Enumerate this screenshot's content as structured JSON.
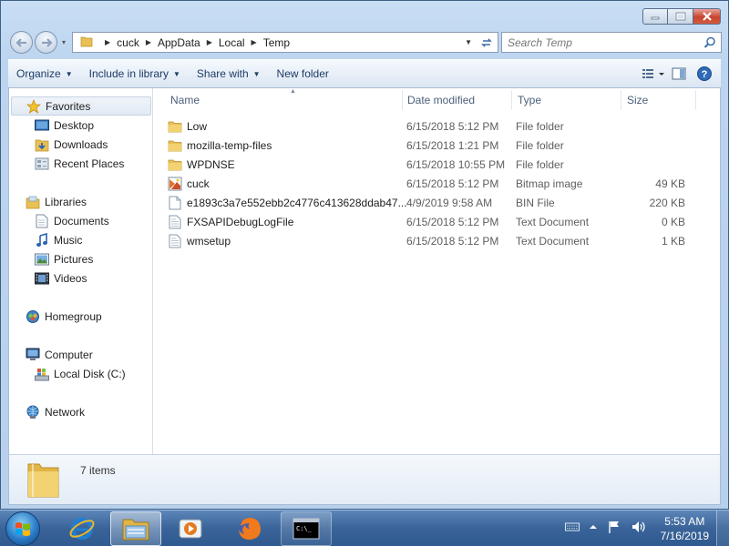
{
  "window": {
    "caption_buttons": {
      "minimize": "minimize-icon",
      "maximize": "maximize-icon",
      "close": "close-icon"
    }
  },
  "address": {
    "crumbs": [
      "cuck",
      "AppData",
      "Local",
      "Temp"
    ],
    "search_placeholder": "Search Temp"
  },
  "toolbar": {
    "organize": "Organize",
    "include_in_library": "Include in library",
    "share_with": "Share with",
    "new_folder": "New folder"
  },
  "nav": {
    "favorites": "Favorites",
    "desktop": "Desktop",
    "downloads": "Downloads",
    "recent_places": "Recent Places",
    "libraries": "Libraries",
    "documents": "Documents",
    "music": "Music",
    "pictures": "Pictures",
    "videos": "Videos",
    "homegroup": "Homegroup",
    "computer": "Computer",
    "local_disk": "Local Disk (C:)",
    "network": "Network"
  },
  "columns": {
    "name": "Name",
    "date": "Date modified",
    "type": "Type",
    "size": "Size"
  },
  "files": [
    {
      "name": "Low",
      "date": "6/15/2018 5:12 PM",
      "type": "File folder",
      "size": "",
      "icon": "folder-icon"
    },
    {
      "name": "mozilla-temp-files",
      "date": "6/15/2018 1:21 PM",
      "type": "File folder",
      "size": "",
      "icon": "folder-icon"
    },
    {
      "name": "WPDNSE",
      "date": "6/15/2018 10:55 PM",
      "type": "File folder",
      "size": "",
      "icon": "folder-icon"
    },
    {
      "name": "cuck",
      "date": "6/15/2018 5:12 PM",
      "type": "Bitmap image",
      "size": "49 KB",
      "icon": "bitmap-icon"
    },
    {
      "name": "e1893c3a7e552ebb2c4776c413628ddab47...",
      "date": "4/9/2019 9:58 AM",
      "type": "BIN File",
      "size": "220 KB",
      "icon": "file-icon"
    },
    {
      "name": "FXSAPIDebugLogFile",
      "date": "6/15/2018 5:12 PM",
      "type": "Text Document",
      "size": "0 KB",
      "icon": "text-file-icon"
    },
    {
      "name": "wmsetup",
      "date": "6/15/2018 5:12 PM",
      "type": "Text Document",
      "size": "1 KB",
      "icon": "text-file-icon"
    }
  ],
  "status": {
    "item_count": "7 items"
  },
  "taskbar": {
    "time": "5:53 AM",
    "date": "7/16/2019"
  }
}
